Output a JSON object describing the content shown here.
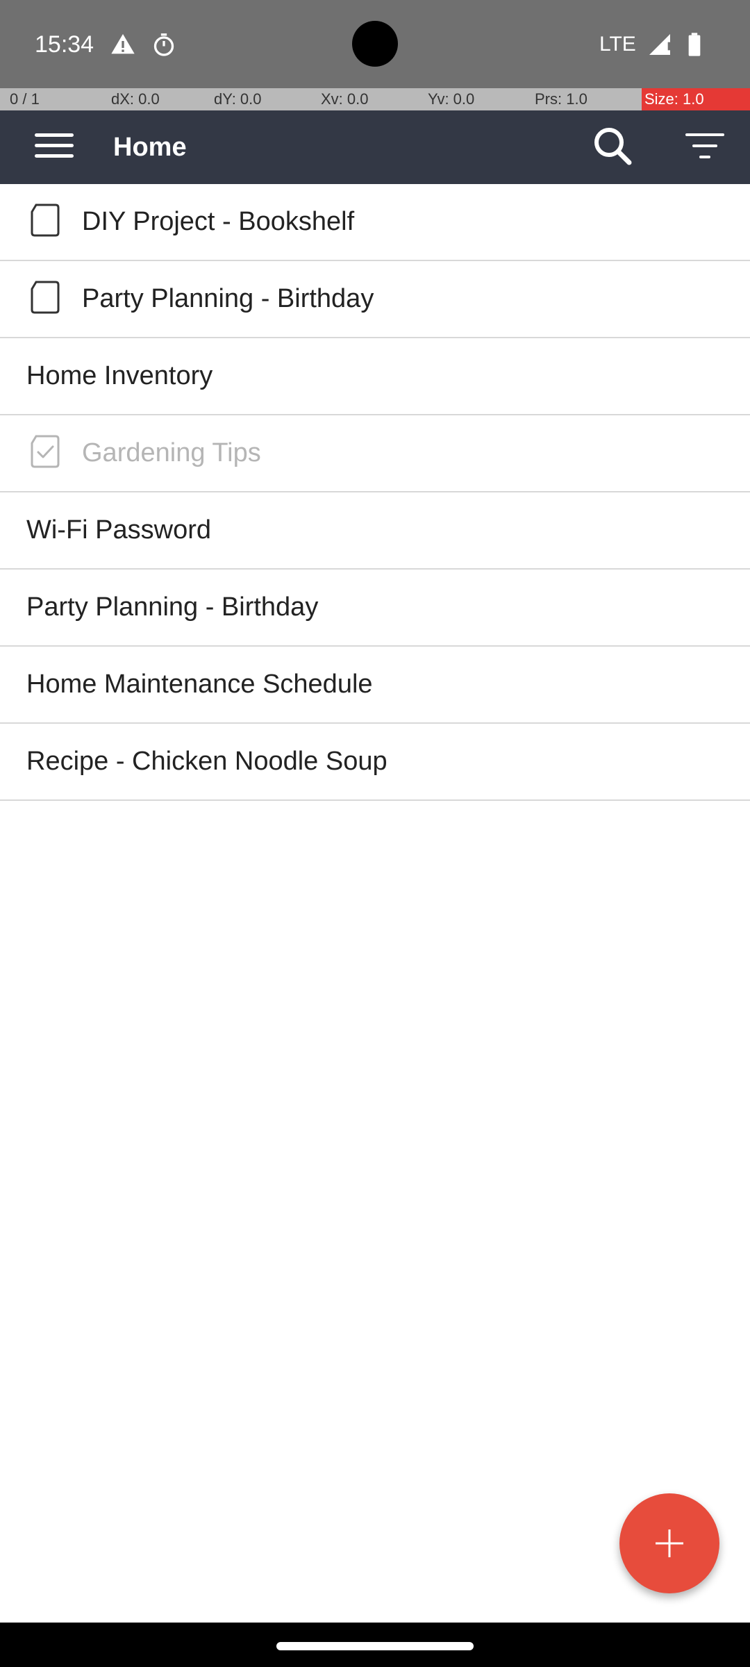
{
  "status_bar": {
    "time": "15:34",
    "network": "LTE",
    "icons": [
      "warning-icon",
      "stopwatch-icon",
      "signal-icon",
      "battery-icon"
    ]
  },
  "debug_overlay": {
    "pointer": "0 / 1",
    "dx": "dX: 0.0",
    "dy": "dY: 0.0",
    "xv": "Xv: 0.0",
    "yv": "Yv: 0.0",
    "prs": "Prs: 1.0",
    "size": "Size: 1.0"
  },
  "app_bar": {
    "title": "Home",
    "menu_icon": "hamburger-menu-icon",
    "search_icon": "search-icon",
    "sort_icon": "sort-filter-icon",
    "background": "#333845"
  },
  "notes": [
    {
      "title": "DIY Project - Bookshelf",
      "has_checkbox": true,
      "checked": false
    },
    {
      "title": "Party Planning - Birthday",
      "has_checkbox": true,
      "checked": false
    },
    {
      "title": "Home Inventory",
      "has_checkbox": false,
      "checked": false
    },
    {
      "title": "Gardening Tips",
      "has_checkbox": true,
      "checked": true
    },
    {
      "title": "Wi-Fi Password",
      "has_checkbox": false,
      "checked": false
    },
    {
      "title": "Party Planning - Birthday",
      "has_checkbox": false,
      "checked": false
    },
    {
      "title": "Home Maintenance Schedule",
      "has_checkbox": false,
      "checked": false
    },
    {
      "title": "Recipe - Chicken Noodle Soup",
      "has_checkbox": false,
      "checked": false
    }
  ],
  "fab": {
    "icon": "plus-icon",
    "color": "#e74c3c"
  }
}
